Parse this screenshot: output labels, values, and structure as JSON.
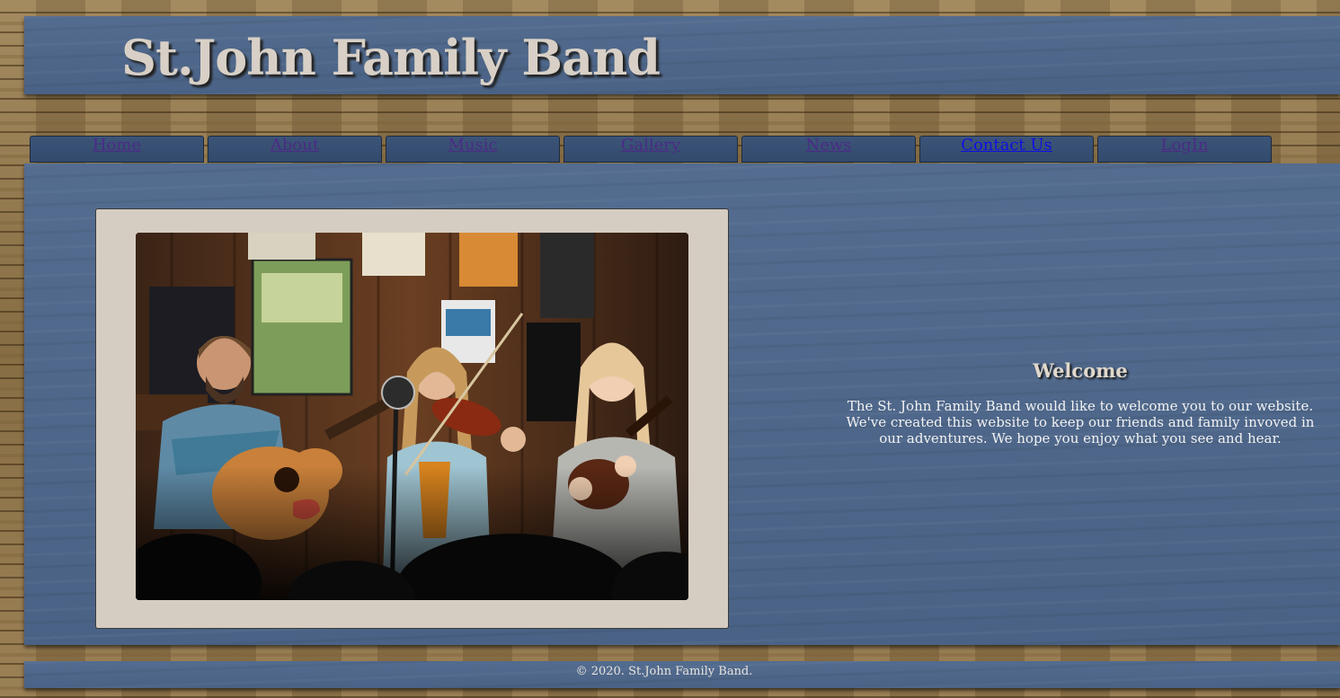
{
  "header": {
    "title": "St.John Family Band"
  },
  "nav": {
    "items": [
      {
        "label": "Home"
      },
      {
        "label": "About"
      },
      {
        "label": "Music"
      },
      {
        "label": "Gallery"
      },
      {
        "label": "News"
      },
      {
        "label": "Contact Us"
      },
      {
        "label": "LogIn"
      }
    ],
    "active": "Contact Us"
  },
  "main": {
    "photo_icon": "band-photo",
    "welcome": {
      "heading": "Welcome",
      "text": "The St. John Family Band would like to welcome you to our website. We've created this website to keep our friends and family invoved in our adventures. We hope you enjoy what you see and hear."
    }
  },
  "footer": {
    "copyright": "© 2020. St.John Family Band."
  },
  "colors": {
    "panel_blue": "#4e6688",
    "nav_tab": "#3c5478",
    "link_visited": "#4b2b86",
    "link_active": "#1010e0",
    "title_text": "#d8d0c6",
    "frame": "#d5cdc2"
  }
}
